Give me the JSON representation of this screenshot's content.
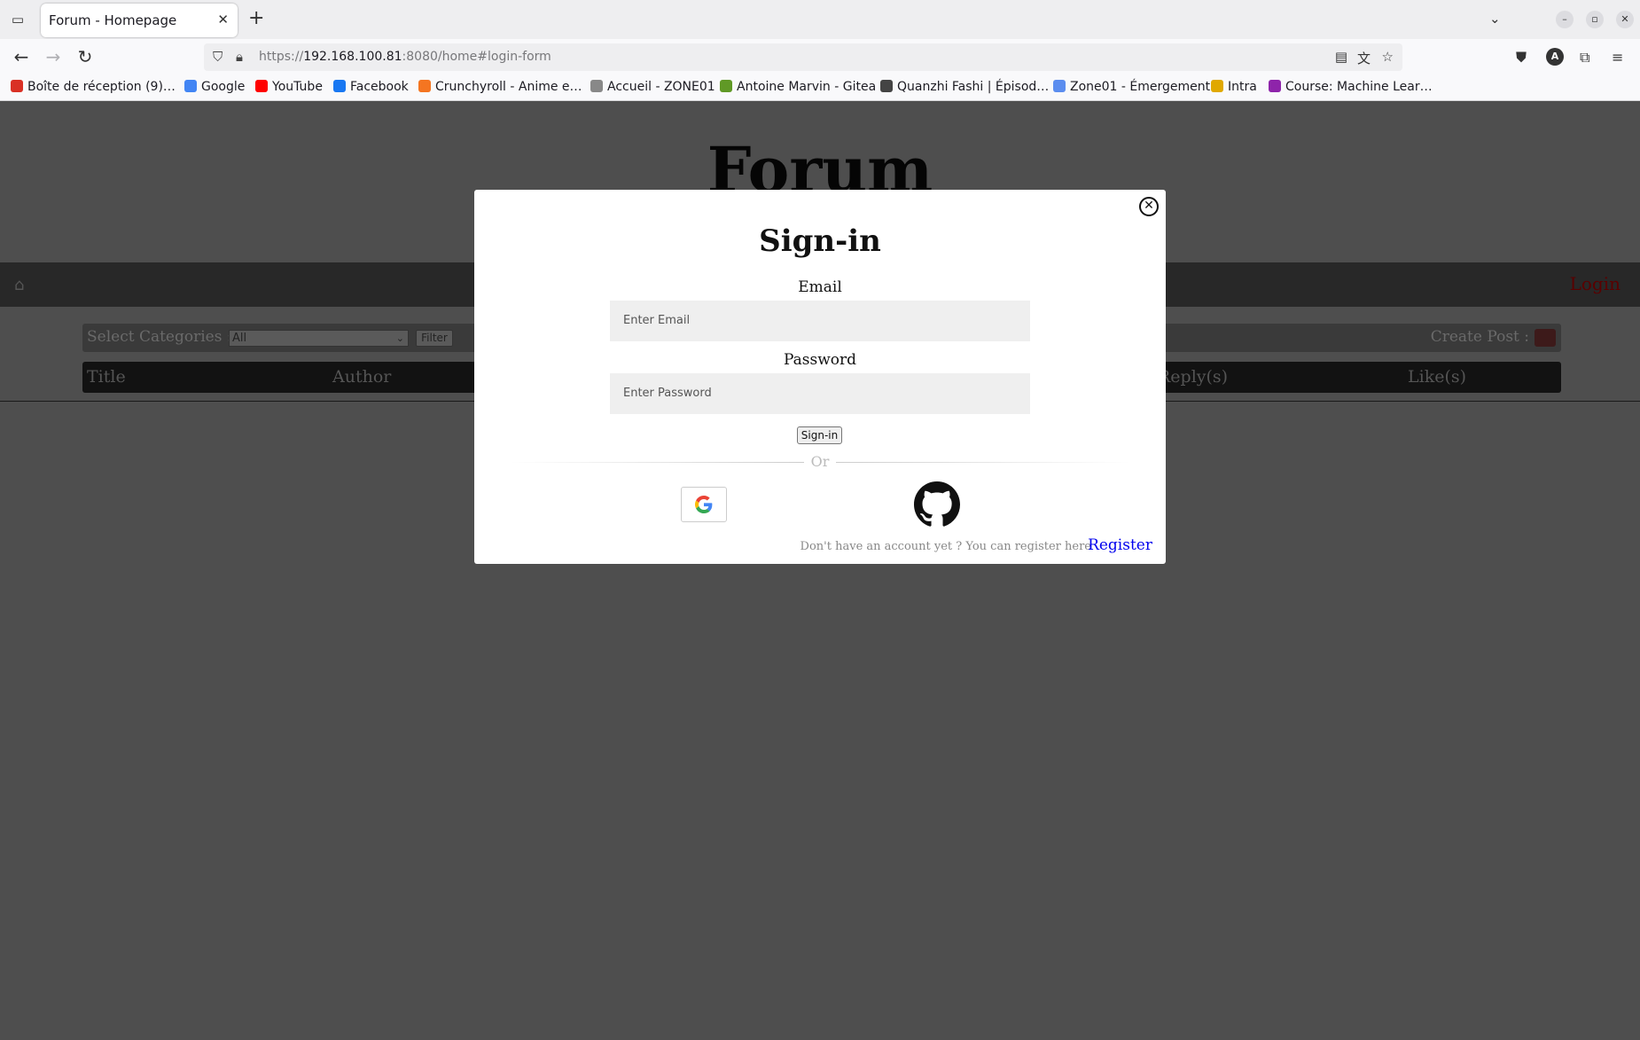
{
  "browser": {
    "tab_title": "Forum - Homepage",
    "url_prefix": "https://",
    "url_host": "192.168.100.81",
    "url_rest": ":8080/home#login-form",
    "avatar_letter": "A",
    "bookmarks": [
      {
        "label": "Boîte de réception (9)…",
        "icon": "gmail-icon",
        "color": "#d93025"
      },
      {
        "label": "Google",
        "icon": "google-icon",
        "color": "#4285f4"
      },
      {
        "label": "YouTube",
        "icon": "youtube-icon",
        "color": "#ff0000"
      },
      {
        "label": "Facebook",
        "icon": "facebook-icon",
        "color": "#1877f2"
      },
      {
        "label": "Crunchyroll - Anime e…",
        "icon": "crunchyroll-icon",
        "color": "#f47521"
      },
      {
        "label": "Accueil - ZONE01",
        "icon": "zone01-icon",
        "color": "#888888"
      },
      {
        "label": "Antoine Marvin - Gitea",
        "icon": "gitea-icon",
        "color": "#609926"
      },
      {
        "label": "Quanzhi Fashi | Épisod…",
        "icon": "globe-icon",
        "color": "#444444"
      },
      {
        "label": "Zone01 - Émergement",
        "icon": "zone01-doc-icon",
        "color": "#5b8def"
      },
      {
        "label": "Intra",
        "icon": "code-icon",
        "color": "#e0a800"
      },
      {
        "label": "Course: Machine Lear…",
        "icon": "moodle-icon",
        "color": "#8e24aa"
      }
    ]
  },
  "site": {
    "title": "Forum",
    "login": "Login",
    "select_categories": "Select Categories :",
    "select_value": "All",
    "filter": "Filter",
    "create_post": "Create Post :",
    "columns": [
      "Title",
      "Author",
      "Reply(s)",
      "Like(s)"
    ]
  },
  "modal": {
    "title": "Sign-in",
    "email_label": "Email",
    "email_placeholder": "Enter Email",
    "password_label": "Password",
    "password_placeholder": "Enter Password",
    "submit": "Sign-in",
    "or": "Or",
    "register_prompt": "Don't have an account yet ? You can register here",
    "register_link": "Register"
  }
}
